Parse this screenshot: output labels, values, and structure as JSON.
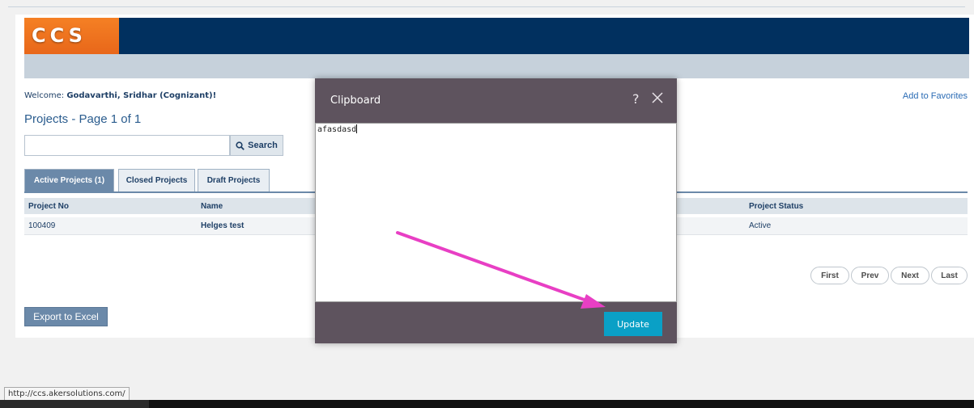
{
  "app": {
    "logo_text": "CCS"
  },
  "page": {
    "welcome_label": "Welcome:",
    "welcome_user": "Godavarthi, Sridhar (Cognizant)!",
    "add_to_favorites": "Add to Favorites",
    "title": "Projects - Page 1 of 1"
  },
  "search": {
    "value": "",
    "placeholder": "",
    "button_label": "Search",
    "icon": "search-icon"
  },
  "tabs": [
    {
      "label": "Active Projects (1)",
      "active": true
    },
    {
      "label": "Closed Projects",
      "active": false
    },
    {
      "label": "Draft Projects",
      "active": false
    }
  ],
  "table": {
    "columns": [
      "Project No",
      "Name",
      "Project Status"
    ],
    "rows": [
      {
        "project_no": "100409",
        "name": "Helges test",
        "status": "Active"
      }
    ]
  },
  "pagination": {
    "first": "First",
    "prev": "Prev",
    "next": "Next",
    "last": "Last"
  },
  "export_button": "Export to Excel",
  "status_bar_url": "http://ccs.akersolutions.com/",
  "modal": {
    "title": "Clipboard",
    "help_icon": "?",
    "close_icon": "close-icon",
    "textarea_value": "afasdasd",
    "update_button": "Update"
  },
  "annotation": {
    "arrow_color": "#e83fc4",
    "points_to": "update-button"
  },
  "colors": {
    "header_navy": "#01305f",
    "logo_orange": "#f58024",
    "modal_header": "#5e535e",
    "update_button": "#0aa0c6",
    "tab_active": "#6b89a9"
  }
}
